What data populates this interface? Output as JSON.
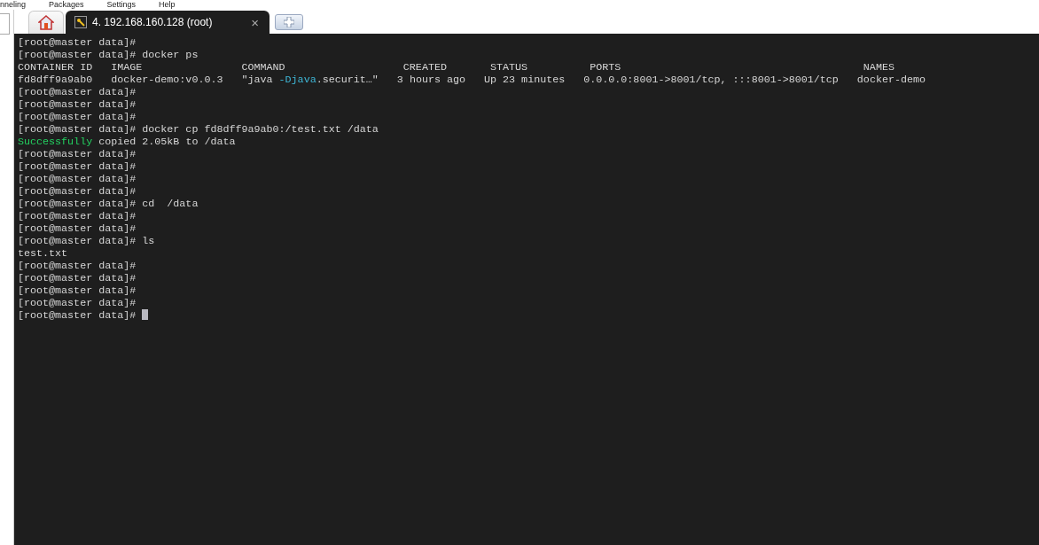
{
  "menu": [
    "nneling",
    "Packages",
    "Settings",
    "Help"
  ],
  "tabs": [
    {
      "kind": "home",
      "selected": false
    },
    {
      "kind": "session",
      "label": "4. 192.168.160.128 (root)",
      "close": "×",
      "selected": true
    }
  ],
  "terminal": {
    "lines": [
      {
        "segments": [
          {
            "text": "[root@master data]#"
          }
        ]
      },
      {
        "segments": [
          {
            "text": "[root@master data]# docker ps"
          }
        ]
      },
      {
        "segments": [
          {
            "text": "CONTAINER ID   IMAGE                COMMAND                   CREATED       STATUS          PORTS                                       NAMES"
          }
        ]
      },
      {
        "segments": [
          {
            "text": "fd8dff9a9ab0   docker-demo:v0.0.3   \"java "
          },
          {
            "text": "-Djava",
            "color": "#3fb8d8"
          },
          {
            "text": ".securit…\"   3 hours ago   Up 23 minutes   0.0.0.0:8001->8001/tcp, :::8001->8001/tcp   docker-demo"
          }
        ]
      },
      {
        "segments": [
          {
            "text": "[root@master data]#"
          }
        ]
      },
      {
        "segments": [
          {
            "text": "[root@master data]#"
          }
        ]
      },
      {
        "segments": [
          {
            "text": "[root@master data]#"
          }
        ]
      },
      {
        "segments": [
          {
            "text": "[root@master data]# docker cp fd8dff9a9ab0:/test.txt /data"
          }
        ]
      },
      {
        "segments": [
          {
            "text": "Successfully",
            "color": "#23d160"
          },
          {
            "text": " copied 2.05kB to /data"
          }
        ]
      },
      {
        "segments": [
          {
            "text": "[root@master data]#"
          }
        ]
      },
      {
        "segments": [
          {
            "text": "[root@master data]#"
          }
        ]
      },
      {
        "segments": [
          {
            "text": "[root@master data]#"
          }
        ]
      },
      {
        "segments": [
          {
            "text": "[root@master data]#"
          }
        ]
      },
      {
        "segments": [
          {
            "text": "[root@master data]# cd  /data"
          }
        ]
      },
      {
        "segments": [
          {
            "text": "[root@master data]#"
          }
        ]
      },
      {
        "segments": [
          {
            "text": "[root@master data]#"
          }
        ]
      },
      {
        "segments": [
          {
            "text": "[root@master data]# ls"
          }
        ]
      },
      {
        "segments": [
          {
            "text": "test.txt"
          }
        ]
      },
      {
        "segments": [
          {
            "text": "[root@master data]#"
          }
        ]
      },
      {
        "segments": [
          {
            "text": "[root@master data]#"
          }
        ]
      },
      {
        "segments": [
          {
            "text": "[root@master data]#"
          }
        ]
      },
      {
        "segments": [
          {
            "text": "[root@master data]#"
          }
        ]
      },
      {
        "segments": [
          {
            "text": "[root@master data]# "
          }
        ],
        "cursor": true
      }
    ]
  }
}
